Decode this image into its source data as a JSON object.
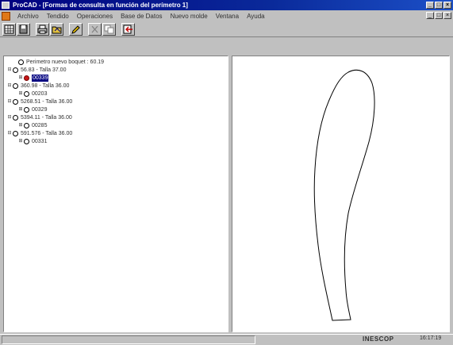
{
  "window": {
    "title": "ProCAD - [Formas de consulta en función del perímetro 1]"
  },
  "menu": {
    "items": [
      {
        "label": "Archivo"
      },
      {
        "label": "Tendido"
      },
      {
        "label": "Operaciones"
      },
      {
        "label": "Base de Datos"
      },
      {
        "label": "Nuevo molde"
      },
      {
        "label": "Ventana"
      },
      {
        "label": "Ayuda"
      }
    ]
  },
  "toolbar": {
    "buttons": [
      {
        "icon": "grid-icon"
      },
      {
        "icon": "save-icon"
      },
      {
        "icon": "print-icon"
      },
      {
        "icon": "open-icon"
      },
      {
        "icon": "pencil-icon"
      },
      {
        "icon": "cut-icon"
      },
      {
        "icon": "copy-icon"
      },
      {
        "icon": "exit-icon"
      }
    ]
  },
  "tree": {
    "root": "Perimetro nuevo boquet : 60.19",
    "groups": [
      {
        "label": "56.83 - Talla 37.00",
        "child": "00339",
        "selected": true
      },
      {
        "label": "360.98 - Talla 36.00",
        "child": "00203",
        "selected": false
      },
      {
        "label": "5268.51 - Talla 36.00",
        "child": "00329",
        "selected": false
      },
      {
        "label": "5394.11 - Talla 36.00",
        "child": "00285",
        "selected": false
      },
      {
        "label": "591.576 - Talla 36.00",
        "child": "00331",
        "selected": false
      }
    ]
  },
  "status": {
    "brand": "INESCOP",
    "time": "16:17:19"
  },
  "colors": {
    "titlebar": "#000080",
    "selection": "#000080",
    "selected_node": "#c81818",
    "face": "#c0c0c0"
  }
}
